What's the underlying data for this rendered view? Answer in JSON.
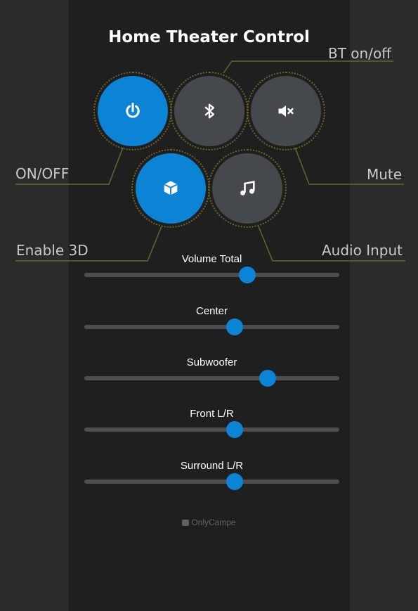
{
  "app": {
    "title": "Home Theater Control"
  },
  "colors": {
    "accent": "#0b84d6",
    "callout_line": "#6a6526"
  },
  "buttons": [
    {
      "id": "power",
      "icon": "power-icon",
      "state": "on"
    },
    {
      "id": "bluetooth",
      "icon": "bluetooth-icon",
      "state": "off"
    },
    {
      "id": "mute",
      "icon": "volume-mute-icon",
      "state": "off"
    },
    {
      "id": "3d",
      "icon": "cube-icon",
      "state": "on"
    },
    {
      "id": "audio",
      "icon": "music-note-icon",
      "state": "off"
    }
  ],
  "callouts": {
    "bt": "BT on/off",
    "onoff": "ON/OFF",
    "mute": "Mute",
    "enable3d": "Enable 3D",
    "audio": "Audio Input"
  },
  "sliders": [
    {
      "label": "Volume Total",
      "value": 0.64
    },
    {
      "label": "Center",
      "value": 0.59
    },
    {
      "label": "Subwoofer",
      "value": 0.72
    },
    {
      "label": "Front L/R",
      "value": 0.59
    },
    {
      "label": "Surround L/R",
      "value": 0.59
    }
  ],
  "footer": {
    "brand": "OnlyCampe"
  }
}
